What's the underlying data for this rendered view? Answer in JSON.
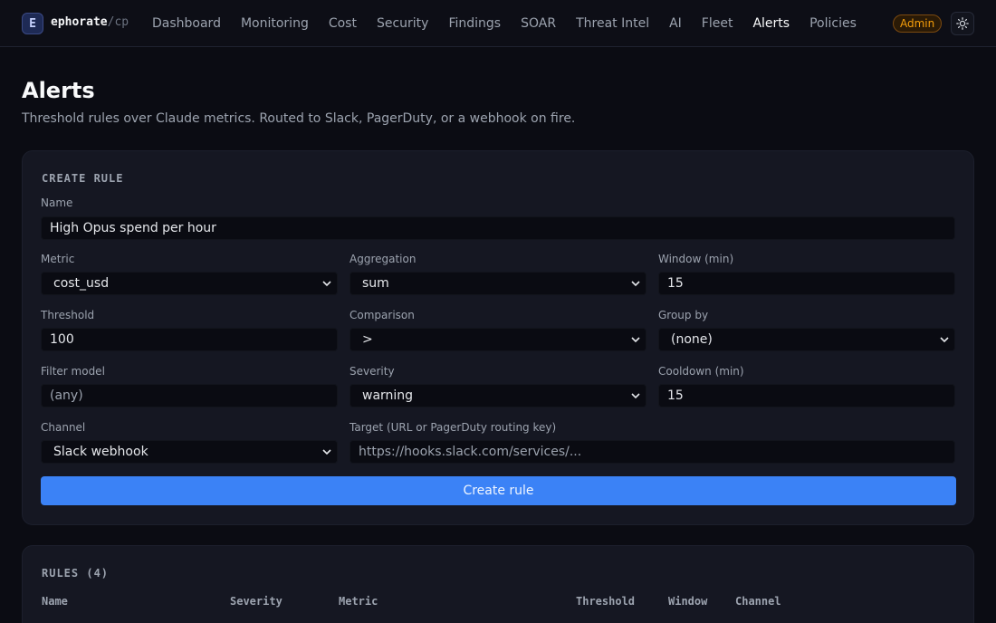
{
  "nav": {
    "logo_letter": "E",
    "brand_name": "ephorate",
    "brand_slash": "/",
    "brand_suffix": "cp",
    "items": [
      {
        "label": "Dashboard"
      },
      {
        "label": "Monitoring"
      },
      {
        "label": "Cost"
      },
      {
        "label": "Security"
      },
      {
        "label": "Findings"
      },
      {
        "label": "SOAR"
      },
      {
        "label": "Threat Intel"
      },
      {
        "label": "AI"
      },
      {
        "label": "Fleet"
      },
      {
        "label": "Alerts",
        "active": true
      },
      {
        "label": "Policies"
      }
    ],
    "role_badge": "Admin",
    "theme_icon": "sun-icon"
  },
  "header": {
    "title": "Alerts",
    "subtitle": "Threshold rules over Claude metrics. Routed to Slack, PagerDuty, or a webhook on fire."
  },
  "create_rule": {
    "section_title": "CREATE RULE",
    "name_label": "Name",
    "name_value": "High Opus spend per hour",
    "metric_label": "Metric",
    "metric_value": "cost_usd",
    "aggregation_label": "Aggregation",
    "aggregation_value": "sum",
    "window_label": "Window (min)",
    "window_value": "15",
    "threshold_label": "Threshold",
    "threshold_value": "100",
    "comparison_label": "Comparison",
    "comparison_value": ">",
    "group_by_label": "Group by",
    "group_by_value": "(none)",
    "filter_model_label": "Filter model",
    "filter_model_placeholder": "(any)",
    "severity_label": "Severity",
    "severity_value": "warning",
    "cooldown_label": "Cooldown (min)",
    "cooldown_value": "15",
    "channel_label": "Channel",
    "channel_value": "Slack webhook",
    "target_label": "Target (URL or PagerDuty routing key)",
    "target_placeholder": "https://hooks.slack.com/services/...",
    "submit_label": "Create rule"
  },
  "rules": {
    "section_title": "RULES (4)",
    "columns": [
      "Name",
      "Severity",
      "Metric",
      "Threshold",
      "Window",
      "Channel"
    ]
  },
  "colors": {
    "accent": "#3b82f6",
    "admin_badge": "#f59e0b",
    "critical": "#f87171"
  }
}
